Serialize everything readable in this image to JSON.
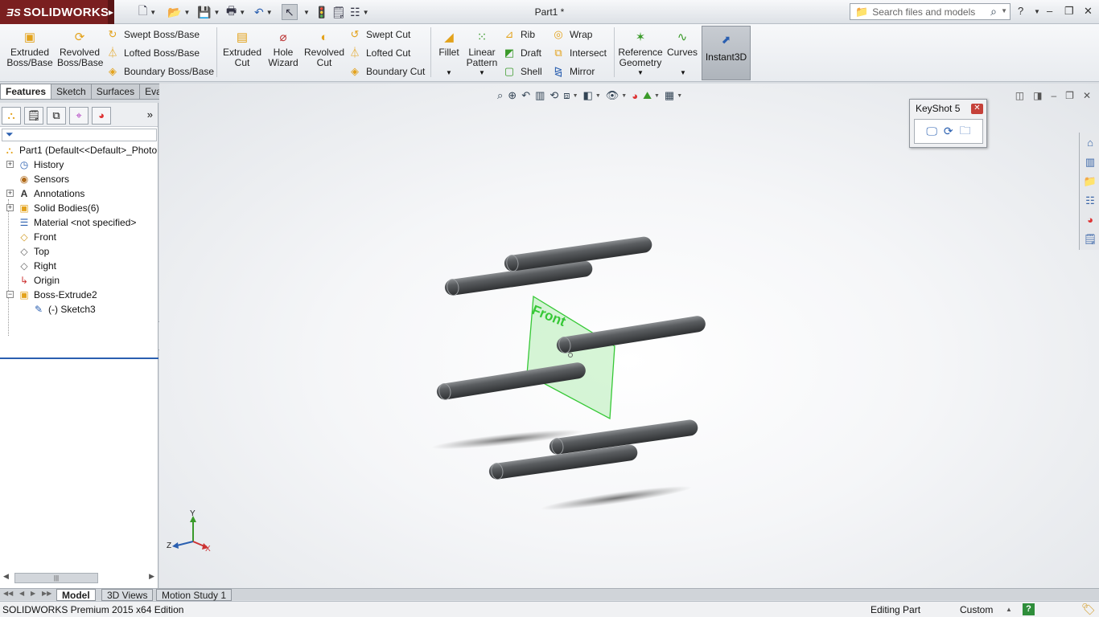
{
  "app": {
    "brand": "SOLIDWORKS",
    "document_title": "Part1 *",
    "search_placeholder": "Search files and models"
  },
  "ribbon": {
    "extruded_boss": "Extruded Boss/Base",
    "revolved_boss": "Revolved Boss/Base",
    "swept_boss": "Swept Boss/Base",
    "lofted_boss": "Lofted Boss/Base",
    "boundary_boss": "Boundary Boss/Base",
    "extruded_cut": "Extruded Cut",
    "hole_wizard": "Hole Wizard",
    "revolved_cut": "Revolved Cut",
    "swept_cut": "Swept Cut",
    "lofted_cut": "Lofted Cut",
    "boundary_cut": "Boundary Cut",
    "fillet": "Fillet",
    "linear_pattern": "Linear Pattern",
    "rib": "Rib",
    "draft": "Draft",
    "shell": "Shell",
    "wrap": "Wrap",
    "intersect": "Intersect",
    "mirror": "Mirror",
    "reference_geometry": "Reference Geometry",
    "curves": "Curves",
    "instant3d": "Instant3D"
  },
  "command_tabs": [
    "Features",
    "Sketch",
    "Surfaces",
    "Evaluate"
  ],
  "tree": {
    "root": "Part1  (Default<<Default>_Photo",
    "history": "History",
    "sensors": "Sensors",
    "annotations": "Annotations",
    "solid_bodies": "Solid Bodies(6)",
    "material": "Material <not specified>",
    "front": "Front",
    "top": "Top",
    "right": "Right",
    "origin": "Origin",
    "boss_extrude": "Boss-Extrude2",
    "sketch": "(-) Sketch3"
  },
  "viewport": {
    "plane_label": "Front",
    "triad_y": "Y",
    "triad_z": "Z",
    "triad_x": "X"
  },
  "keyshot": {
    "title": "KeyShot 5"
  },
  "bottom_tabs": [
    "Model",
    "3D Views",
    "Motion Study 1"
  ],
  "status": {
    "edition": "SOLIDWORKS Premium 2015 x64 Edition",
    "mode": "Editing Part",
    "units": "Custom",
    "help": "?"
  },
  "colors": {
    "brand_red": "#7a1f20",
    "plane_green": "#3ccf3c",
    "cylinder_gray": "#4f5153"
  }
}
